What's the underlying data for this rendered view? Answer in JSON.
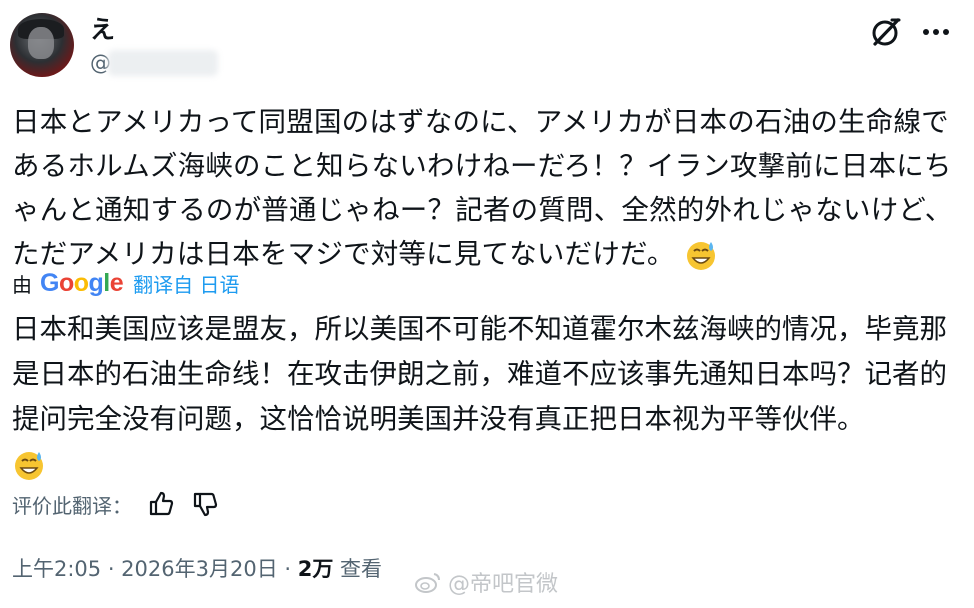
{
  "post": {
    "display_name": "え",
    "handle": "@",
    "original_text": "日本とアメリカって同盟国のはずなのに、アメリカが日本の石油の生命線であるホルムズ海峡のこと知らないわけねーだろ！？イラン攻撃前に日本にちゃんと通知するのが普通じゃねー？記者の質問、全然的外れじゃないけど、ただアメリカは日本をマジで対等に見てないだけだ。",
    "translated_by": "由",
    "translator": "Google",
    "translate_label": "翻译自 日语",
    "translated_text": "日本和美国应该是盟友，所以美国不可能不知道霍尔木兹海峡的情况，毕竟那是日本的石油生命线！在攻击伊朗之前，难道不应该事先通知日本吗？记者的提问完全没有问题，这恰恰说明美国并没有真正把日本视为平等伙伴。",
    "rate_label": "评价此翻译：",
    "time": "上午2:05 · 2026年3月20日 · ",
    "views_count": "2万",
    "views_label": " 查看"
  },
  "watermark": "@帝吧官微",
  "icons": [
    "grok-icon",
    "more-icon",
    "thumbs-up-icon",
    "thumbs-down-icon",
    "sweat-smile-emoji",
    "weibo-icon"
  ],
  "colors": {
    "link": "#1d9bf0",
    "muted": "#536471",
    "text": "#0f1419"
  }
}
